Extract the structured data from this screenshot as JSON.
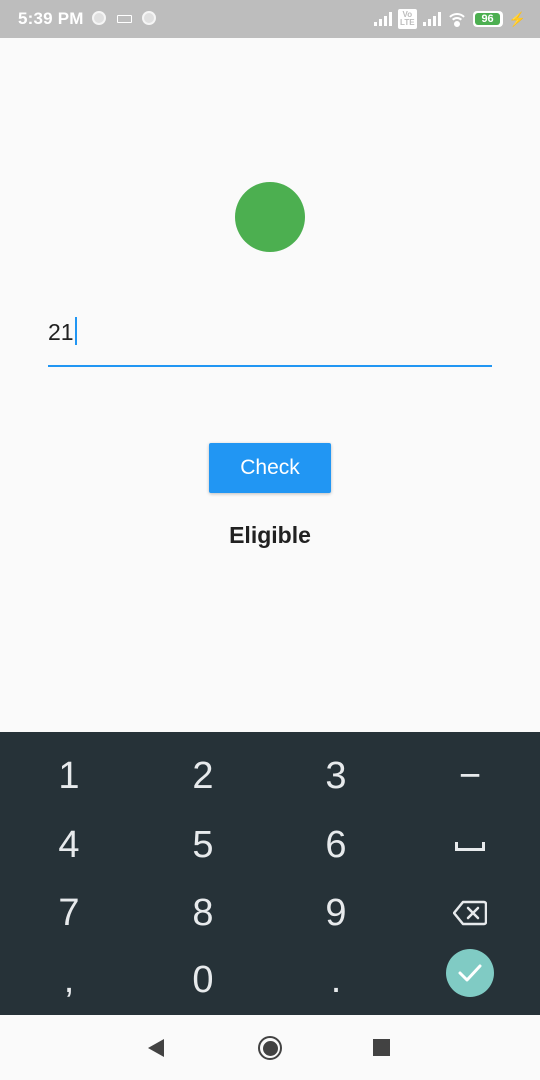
{
  "status_bar": {
    "time": "5:39 PM",
    "volte": "Vo LTE",
    "battery_level": "96",
    "battery_fraction": 0.96
  },
  "indicator": {
    "color": "#4caf50"
  },
  "age_input": {
    "value": "21"
  },
  "check_button": {
    "label": "Check"
  },
  "result": {
    "text": "Eligible"
  },
  "keyboard": {
    "rows": [
      [
        "1",
        "2",
        "3",
        "−"
      ],
      [
        "4",
        "5",
        "6",
        "space"
      ],
      [
        "7",
        "8",
        "9",
        "backspace"
      ],
      [
        ",",
        "0",
        ".",
        "done"
      ]
    ]
  },
  "colors": {
    "accent": "#2196f3",
    "keyboard_bg": "#263238",
    "done_button": "#80cbc4"
  }
}
